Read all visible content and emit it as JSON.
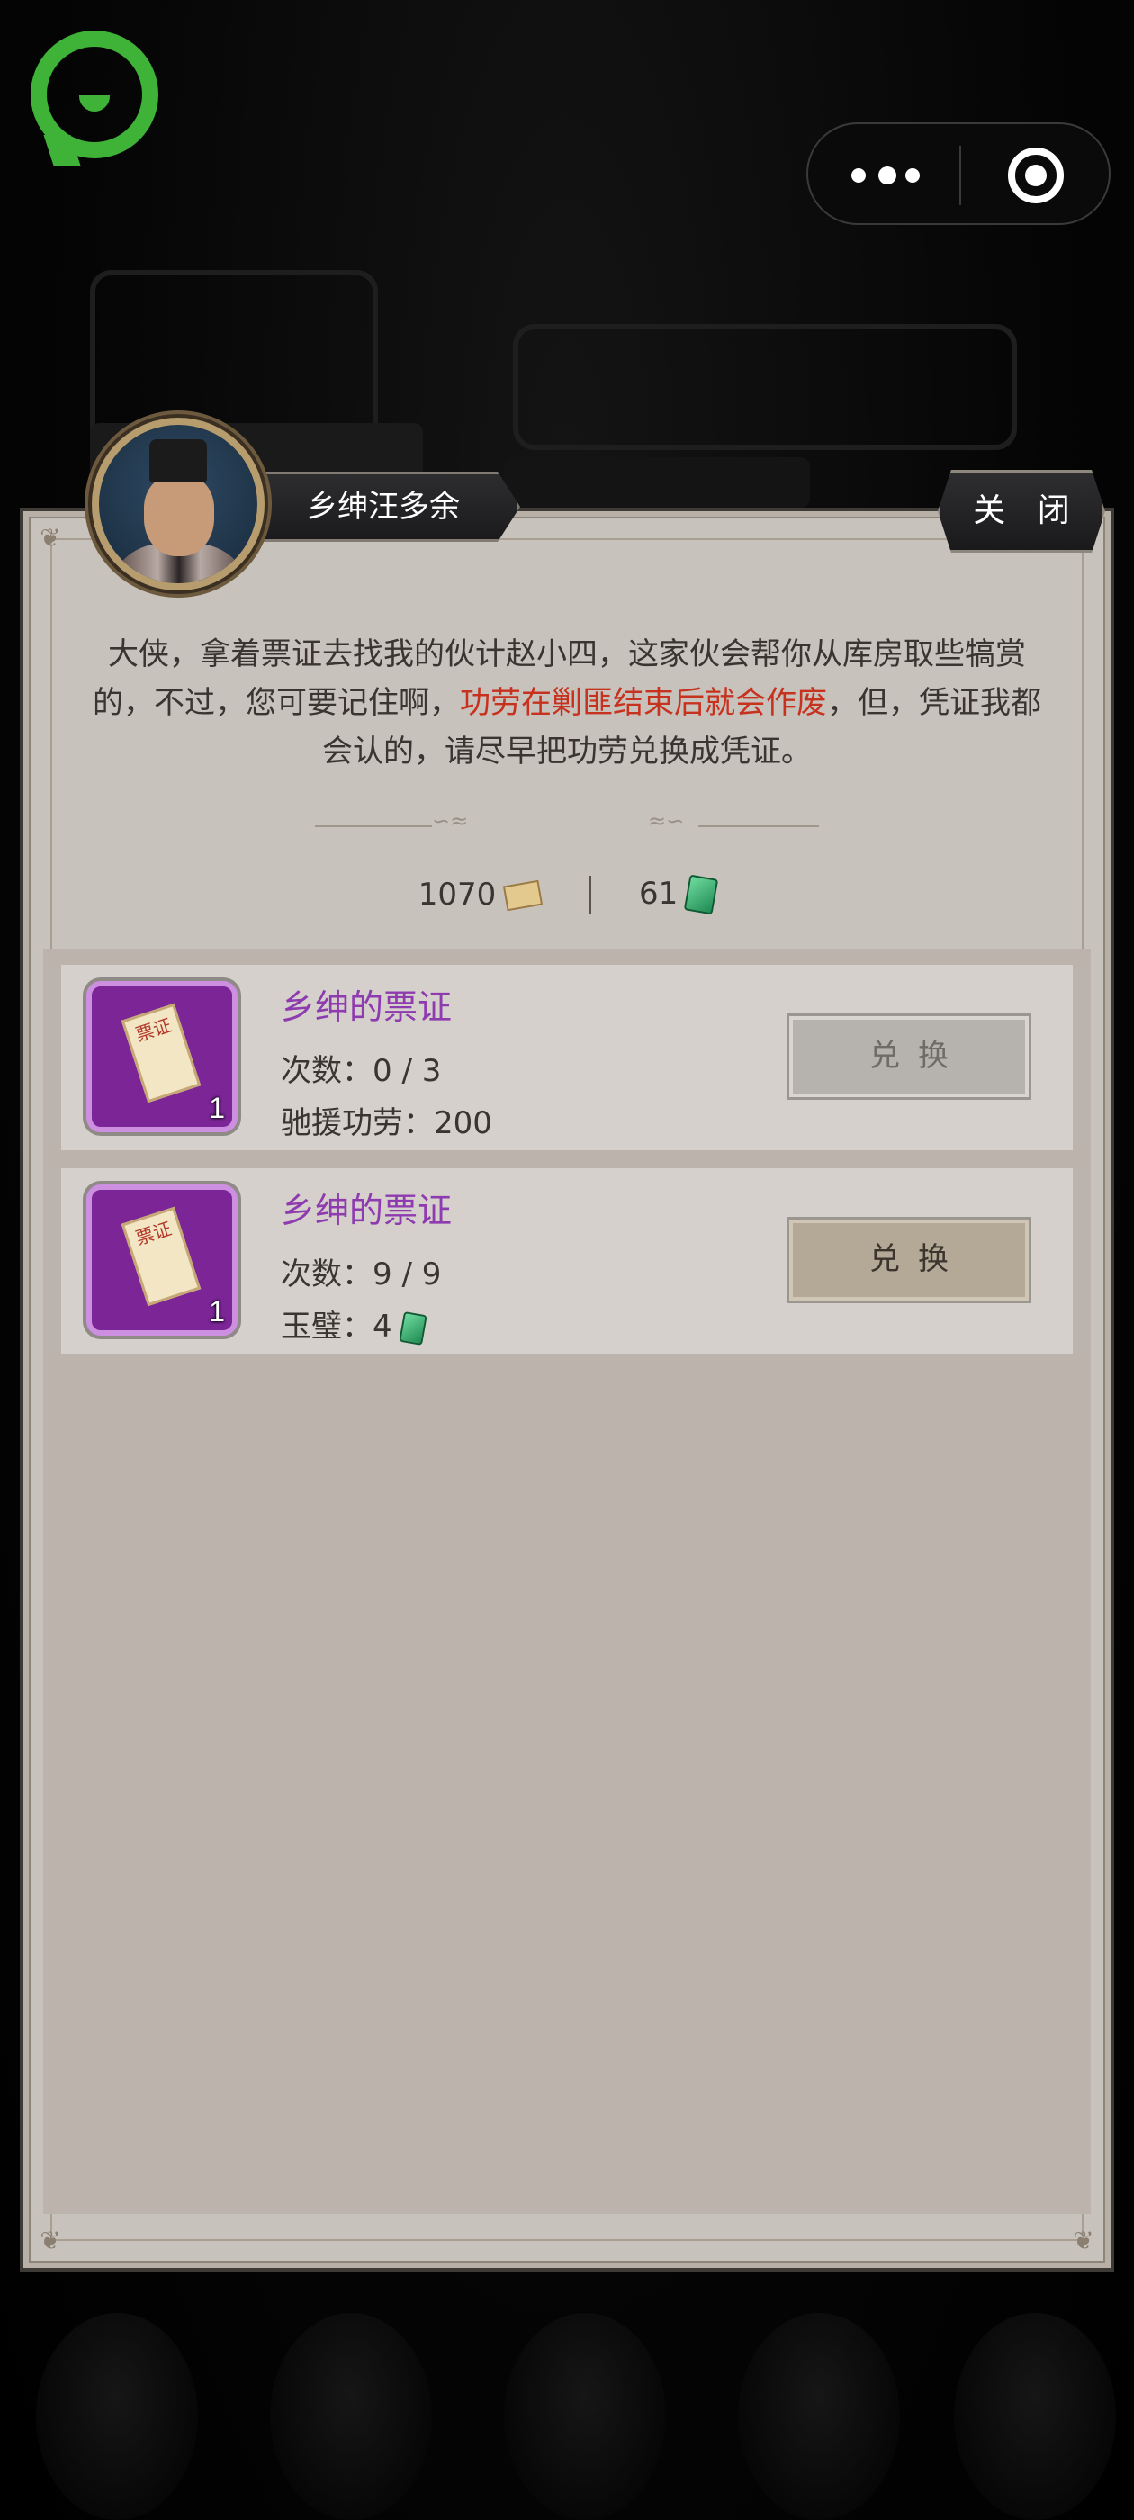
{
  "miniprogram": {
    "logo_icon": "wechat-miniprogram-logo",
    "more_icon": "more-dots-icon",
    "exit_icon": "target-exit-icon"
  },
  "npc": {
    "name": "乡绅汪多余",
    "avatar_icon": "npc-portrait"
  },
  "header": {
    "close_label": "关 闭"
  },
  "dialogue": {
    "text_before": "大侠，拿着票证去找我的伙计赵小四，这家伙会帮你从库房取些犒赏的，不过，您可要记住啊，",
    "text_highlight": "功劳在剿匪结束后就会作废",
    "text_after": "，但，凭证我都会认的，请尽早把功劳兑换成凭证。"
  },
  "currencies": {
    "merit_value": "1070",
    "merit_icon": "merit-ticket-icon",
    "jade_value": "61",
    "jade_icon": "jade-icon"
  },
  "rows": [
    {
      "title": "乡绅的票证",
      "line1": "次数：0 / 3",
      "line2": "驰援功劳：200",
      "qty": "1",
      "paper_text": "票证",
      "button_label": "兑换",
      "button_state": "disabled"
    },
    {
      "title": "乡绅的票证",
      "line1": "次数：9 / 9",
      "line2": "玉璧：4",
      "qty": "1",
      "paper_text": "票证",
      "button_label": "兑换",
      "button_state": "active"
    }
  ],
  "colors": {
    "highlight_red": "#c7321f",
    "item_purple": "#8e3bb0",
    "panel_bg": "#c8c2bc"
  }
}
